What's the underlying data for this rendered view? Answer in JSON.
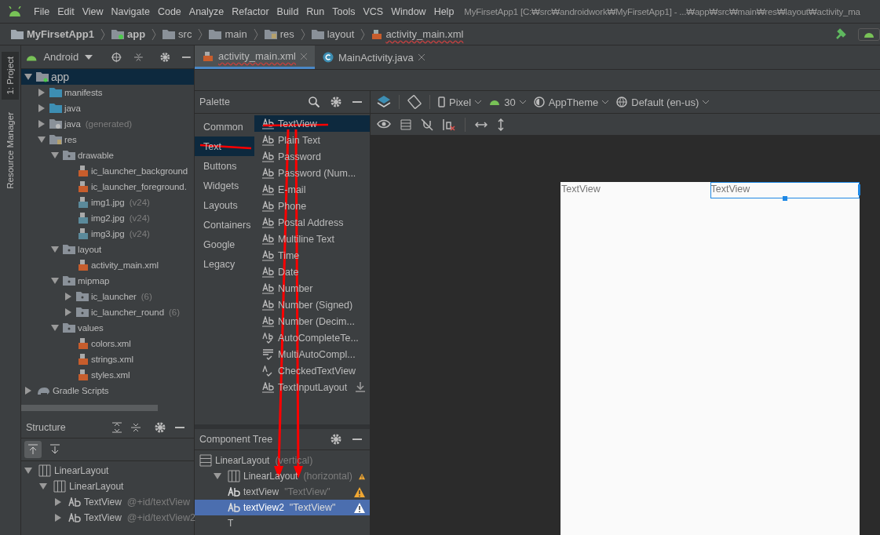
{
  "menu": [
    "File",
    "Edit",
    "View",
    "Navigate",
    "Code",
    "Analyze",
    "Refactor",
    "Build",
    "Run",
    "Tools",
    "VCS",
    "Window",
    "Help"
  ],
  "window": {
    "title": "MyFirsetApp1 [C:₩src₩androidwork₩MyFirsetApp1] - ...₩app₩src₩main₩res₩layout₩activity_ma"
  },
  "breadcrumb": [
    {
      "label": "MyFirsetApp1",
      "kind": "project"
    },
    {
      "label": "app",
      "kind": "module"
    },
    {
      "label": "src",
      "kind": "folder"
    },
    {
      "label": "main",
      "kind": "folder"
    },
    {
      "label": "res",
      "kind": "res"
    },
    {
      "label": "layout",
      "kind": "folder"
    },
    {
      "label": "activity_main.xml",
      "kind": "xml"
    }
  ],
  "side_tabs": [
    {
      "label": "1: Project",
      "selected": true
    },
    {
      "label": "Resource Manager",
      "selected": false
    }
  ],
  "project": {
    "view": "Android",
    "tree": [
      {
        "label": "app",
        "kind": "module",
        "expanded": true,
        "selected": true,
        "children": [
          {
            "label": "manifests",
            "kind": "folder",
            "expanded": false,
            "selected": false
          },
          {
            "label": "java",
            "kind": "folder",
            "expanded": false,
            "selected": false
          },
          {
            "label": "java",
            "note": "(generated)",
            "kind": "gen",
            "expanded": false,
            "selected": false
          },
          {
            "label": "res",
            "kind": "res",
            "expanded": true,
            "selected": false,
            "children": [
              {
                "label": "drawable",
                "kind": "dir",
                "expanded": true,
                "selected": false,
                "children": [
                  {
                    "label": "ic_launcher_background",
                    "kind": "xml",
                    "selected": false
                  },
                  {
                    "label": "ic_launcher_foreground.",
                    "kind": "xml",
                    "selected": false
                  },
                  {
                    "label": "img1.jpg",
                    "note": "(v24)",
                    "kind": "img",
                    "selected": false
                  },
                  {
                    "label": "img2.jpg",
                    "note": "(v24)",
                    "kind": "img",
                    "selected": false
                  },
                  {
                    "label": "img3.jpg",
                    "note": "(v24)",
                    "kind": "img",
                    "selected": false
                  }
                ]
              },
              {
                "label": "layout",
                "kind": "dir",
                "expanded": true,
                "selected": false,
                "children": [
                  {
                    "label": "activity_main.xml",
                    "kind": "xml",
                    "selected": false
                  }
                ]
              },
              {
                "label": "mipmap",
                "kind": "dir",
                "expanded": true,
                "selected": false,
                "children": [
                  {
                    "label": "ic_launcher",
                    "note": "(6)",
                    "kind": "dir",
                    "expanded": false,
                    "selected": false
                  },
                  {
                    "label": "ic_launcher_round",
                    "note": "(6)",
                    "kind": "dir",
                    "expanded": false,
                    "selected": false
                  }
                ]
              },
              {
                "label": "values",
                "kind": "dir",
                "expanded": true,
                "selected": false,
                "children": [
                  {
                    "label": "colors.xml",
                    "kind": "xml",
                    "selected": false
                  },
                  {
                    "label": "strings.xml",
                    "kind": "xml",
                    "selected": false
                  },
                  {
                    "label": "styles.xml",
                    "kind": "xml",
                    "selected": false
                  }
                ]
              }
            ]
          }
        ]
      },
      {
        "label": "Gradle Scripts",
        "kind": "gradle",
        "expanded": false,
        "selected": false
      }
    ]
  },
  "structure": {
    "title": "Structure",
    "tree": [
      {
        "label": "LinearLayout",
        "kind": "hlayout",
        "expanded": true,
        "children": [
          {
            "label": "LinearLayout",
            "kind": "hlayout",
            "expanded": true,
            "children": [
              {
                "label": "TextView",
                "note": "@+id/textView",
                "kind": "text",
                "expanded": false
              },
              {
                "label": "TextView",
                "note": "@+id/textView2",
                "kind": "text",
                "expanded": false
              }
            ]
          }
        ]
      }
    ]
  },
  "editor_tabs": [
    {
      "label": "activity_main.xml",
      "kind": "xml",
      "selected": true
    },
    {
      "label": "MainActivity.java",
      "kind": "class",
      "selected": false
    }
  ],
  "palette": {
    "title": "Palette",
    "categories": [
      {
        "label": "Common",
        "selected": false
      },
      {
        "label": "Text",
        "selected": true
      },
      {
        "label": "Buttons",
        "selected": false
      },
      {
        "label": "Widgets",
        "selected": false
      },
      {
        "label": "Layouts",
        "selected": false
      },
      {
        "label": "Containers",
        "selected": false
      },
      {
        "label": "Google",
        "selected": false
      },
      {
        "label": "Legacy",
        "selected": false
      }
    ],
    "items": [
      {
        "label": "TextView",
        "kind": "ab",
        "selected": true,
        "download": false
      },
      {
        "label": "Plain Text",
        "kind": "ab",
        "selected": false,
        "download": false
      },
      {
        "label": "Password",
        "kind": "ab",
        "selected": false,
        "download": false
      },
      {
        "label": "Password (Num...",
        "kind": "ab",
        "selected": false,
        "download": false
      },
      {
        "label": "E-mail",
        "kind": "ab",
        "selected": false,
        "download": false
      },
      {
        "label": "Phone",
        "kind": "ab",
        "selected": false,
        "download": false
      },
      {
        "label": "Postal Address",
        "kind": "ab",
        "selected": false,
        "download": false
      },
      {
        "label": "Multiline Text",
        "kind": "ab",
        "selected": false,
        "download": false
      },
      {
        "label": "Time",
        "kind": "ab",
        "selected": false,
        "download": false
      },
      {
        "label": "Date",
        "kind": "ab",
        "selected": false,
        "download": false
      },
      {
        "label": "Number",
        "kind": "ab",
        "selected": false,
        "download": false
      },
      {
        "label": "Number (Signed)",
        "kind": "ab",
        "selected": false,
        "download": false
      },
      {
        "label": "Number (Decim...",
        "kind": "ab",
        "selected": false,
        "download": false
      },
      {
        "label": "AutoCompleteTe...",
        "kind": "abcheck",
        "selected": false,
        "download": false
      },
      {
        "label": "MultiAutoCompl...",
        "kind": "lines",
        "selected": false,
        "download": false
      },
      {
        "label": "CheckedTextView",
        "kind": "acheck",
        "selected": false,
        "download": false
      },
      {
        "label": "TextInputLayout",
        "kind": "ab",
        "selected": false,
        "download": true
      }
    ]
  },
  "design_toolbar": {
    "device": "Pixel",
    "api": "30",
    "theme": "AppTheme",
    "locale": "Default (en-us)"
  },
  "canvas": {
    "text_views": [
      {
        "text": "TextView",
        "selected": false
      },
      {
        "text": "TextView",
        "selected": true
      }
    ]
  },
  "component_tree": {
    "title": "Component Tree",
    "tree": [
      {
        "label": "LinearLayout",
        "note": "(vertical)",
        "kind": "vlayout",
        "warning": false,
        "selected": false,
        "children": [
          {
            "label": "LinearLayout",
            "note": "(horizontal)",
            "kind": "hlayout",
            "expanded": true,
            "warning": true,
            "selected": false,
            "children": [
              {
                "label": "textView",
                "note": "\"TextView\"",
                "kind": "text",
                "warning": true,
                "selected": false
              },
              {
                "label": "textView2",
                "note": "\"TextView\"",
                "kind": "text",
                "warning": true,
                "selected": true
              },
              {
                "label": "T",
                "kind": "plain",
                "warning": false,
                "selected": false
              }
            ]
          }
        ]
      }
    ]
  }
}
